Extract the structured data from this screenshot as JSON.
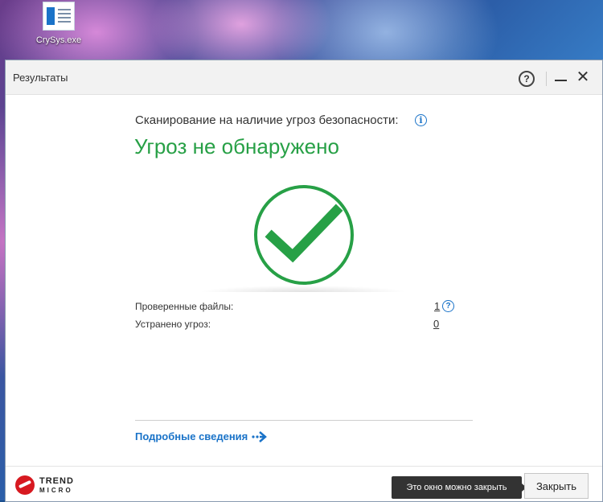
{
  "desktop": {
    "icon_label": "CrySys.exe"
  },
  "window": {
    "title": "Результаты",
    "help_glyph": "?",
    "close_glyph": "✕"
  },
  "scan": {
    "title": "Сканирование на наличие угроз безопасности:",
    "info_glyph": "i",
    "status": "Угроз не обнаружено",
    "status_color": "#27a046"
  },
  "results": [
    {
      "label": "Проверенные файлы:",
      "value": "1"
    },
    {
      "label": "Устранено угроз:",
      "value": "0"
    }
  ],
  "details_link": "Подробные сведения",
  "brand": {
    "line1": "TREND",
    "line2": "MICRO"
  },
  "footer": {
    "tooltip": "Это окно можно закрыть",
    "close_label": "Закрыть"
  },
  "colors": {
    "accent": "#1a73c8",
    "success": "#27a046",
    "brand_red": "#d71920"
  }
}
